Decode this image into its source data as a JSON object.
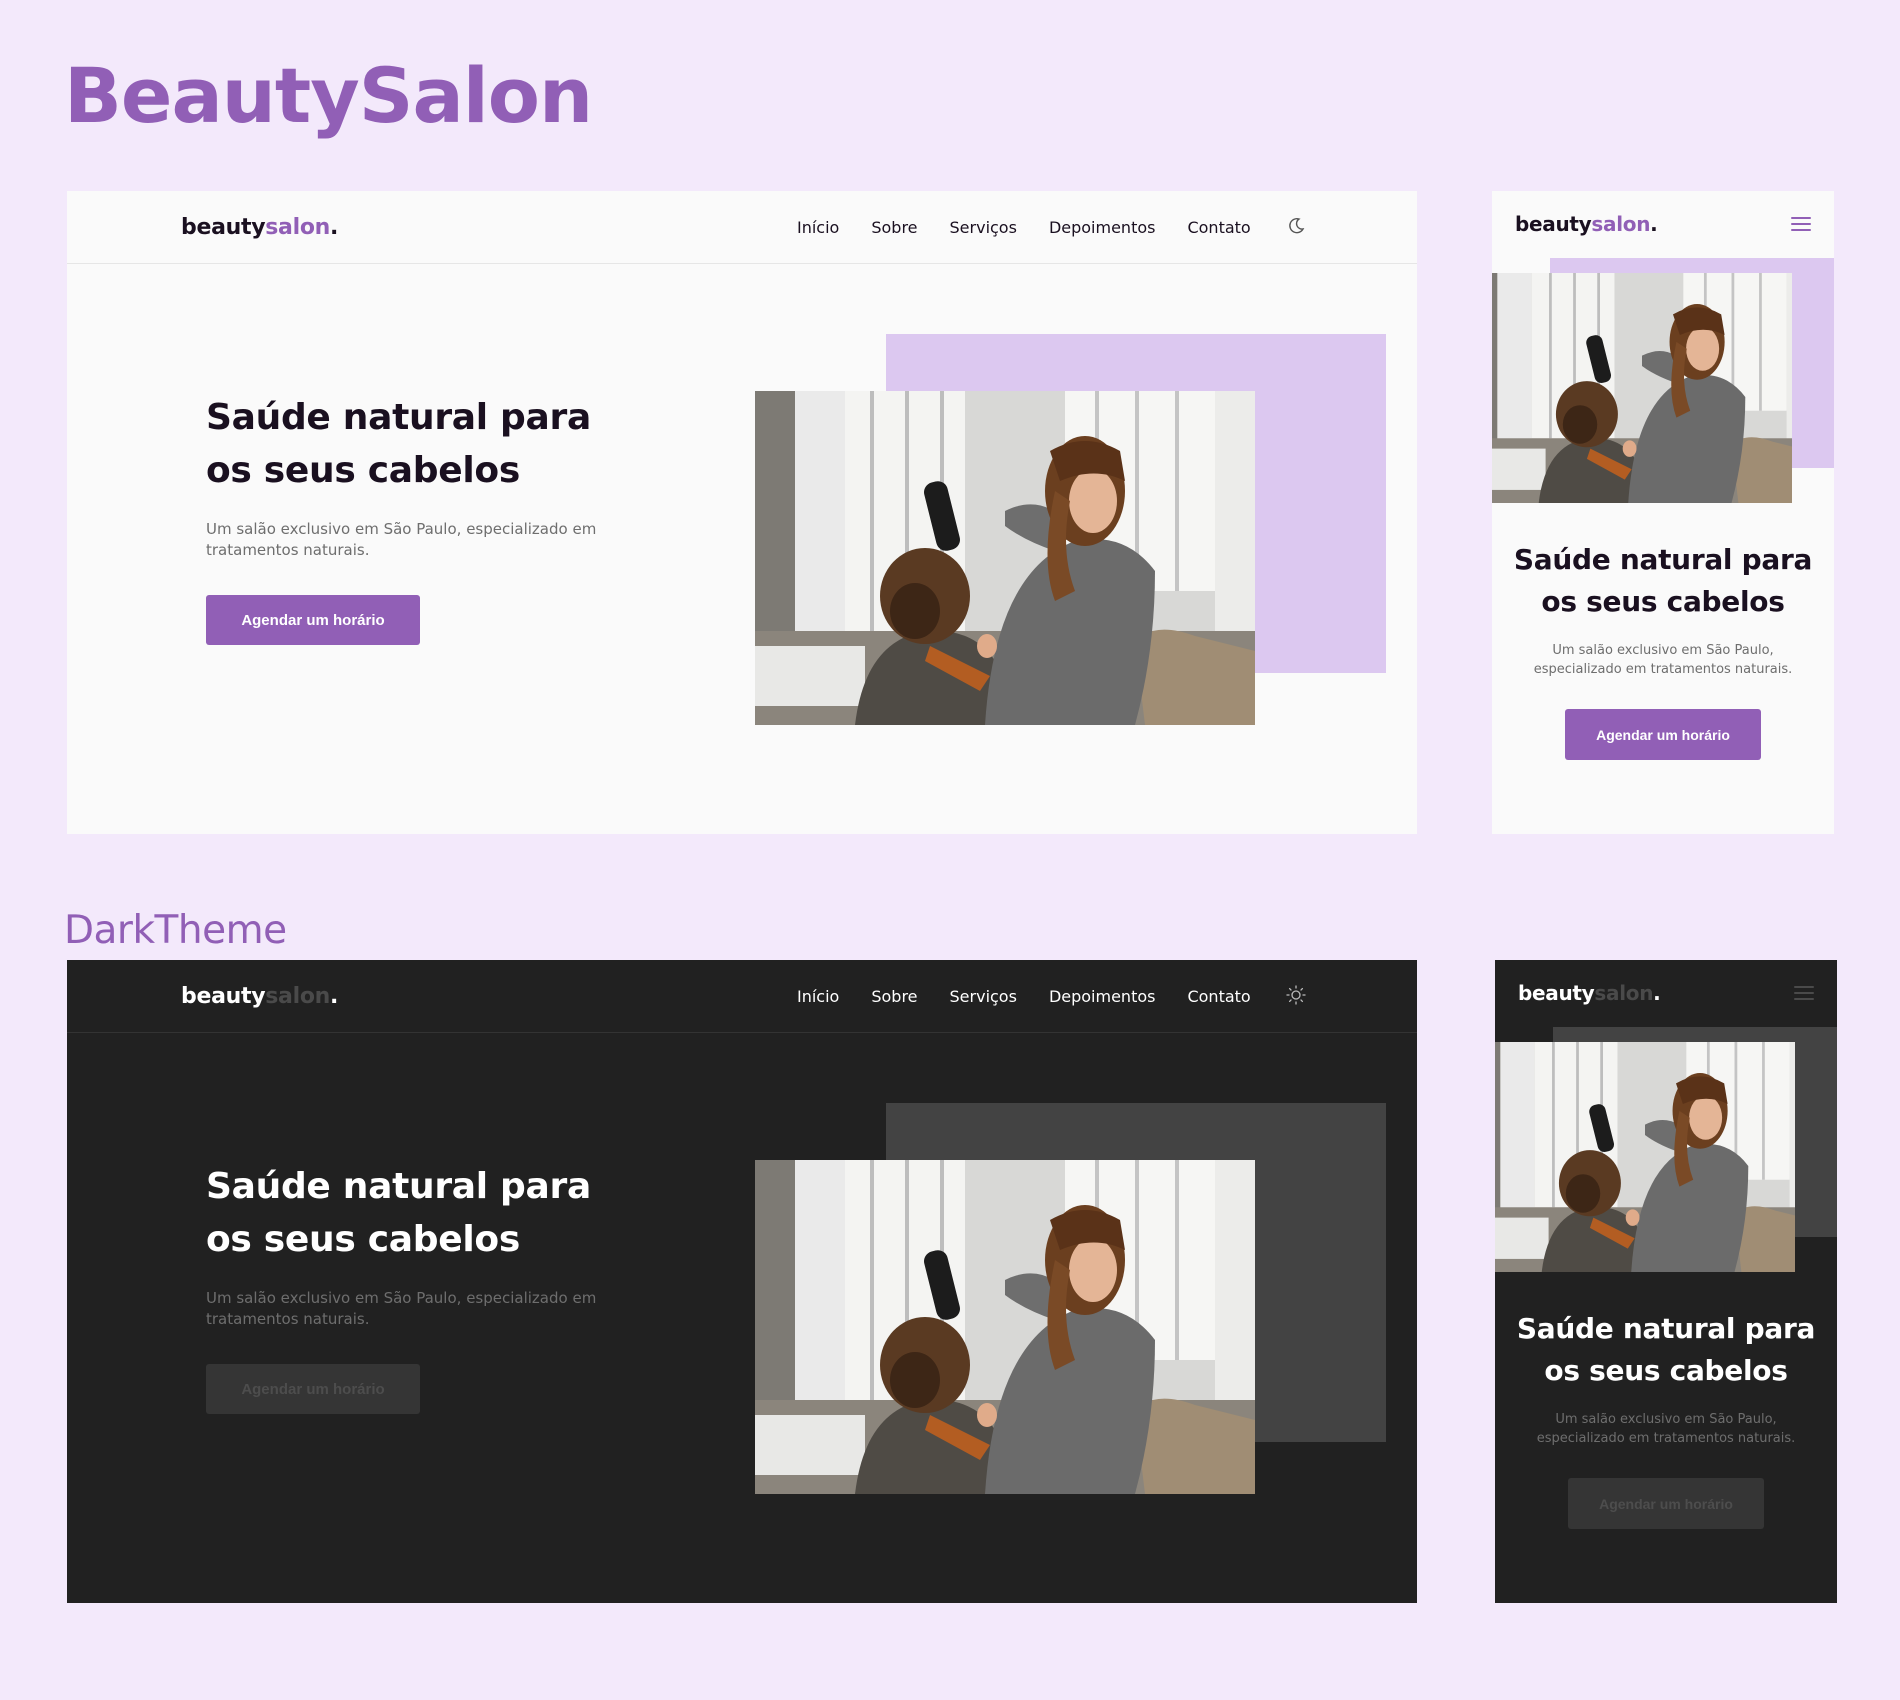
{
  "page": {
    "title": "BeautySalon",
    "dark_section_label": "DarkTheme"
  },
  "logo": {
    "part1": "beauty",
    "part2": "salon",
    "part3": "."
  },
  "nav": {
    "inicio": "Início",
    "sobre": "Sobre",
    "servicos": "Serviços",
    "depoimentos": "Depoimentos",
    "contato": "Contato"
  },
  "hero": {
    "title_line1": "Saúde natural para",
    "title_line2": "os seus cabelos",
    "subtitle_desktop": "Um salão exclusivo em São Paulo, especializado em tratamentos naturais.",
    "subtitle_mobile": "Um salão exclusivo em São Paulo, especializado em tratamentos naturais.",
    "cta": "Agendar um horário"
  },
  "icons": {
    "light_toggle": "moon-icon",
    "dark_toggle": "sun-icon",
    "menu": "hamburger-menu-icon",
    "photo": "hairdresser-photo"
  },
  "colors": {
    "brand_purple": "#915fb6",
    "page_background": "#f3e9fb",
    "light_surface": "#fafafa",
    "light_accent_block": "#dcc8f0",
    "dark_surface": "#212121",
    "dark_accent_block": "#434343",
    "heading_dark": "#1a1020"
  }
}
